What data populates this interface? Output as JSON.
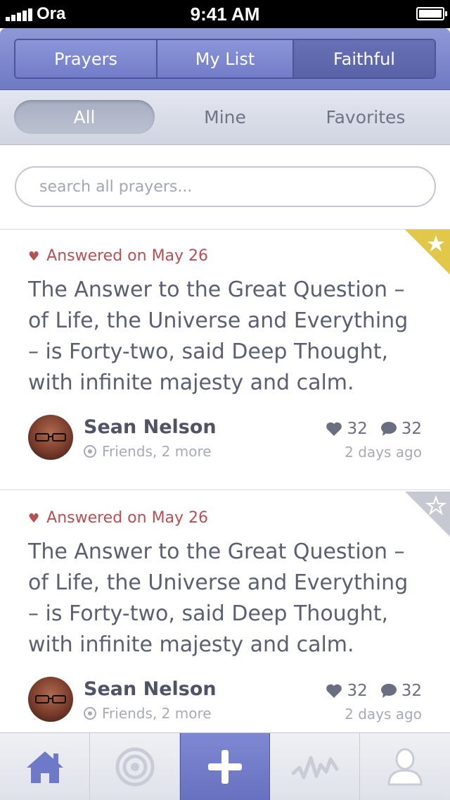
{
  "status_bar": {
    "carrier": "Ora",
    "time": "9:41 AM"
  },
  "nav": {
    "tabs": [
      {
        "label": "Prayers"
      },
      {
        "label": "My List"
      },
      {
        "label": "Faithful",
        "selected": true
      }
    ]
  },
  "filter": {
    "items": [
      {
        "label": "All",
        "selected": true
      },
      {
        "label": "Mine"
      },
      {
        "label": "Favorites"
      }
    ]
  },
  "search": {
    "placeholder": "search all prayers..."
  },
  "prayers": [
    {
      "status": "Answered on May 26",
      "text": "The Answer to the Great Question – of Life, the Universe and Everything – is Forty-two, said Deep Thought, with infinite majesty and calm.",
      "author": "Sean Nelson",
      "audience": "Friends, 2 more",
      "likes": "32",
      "comments": "32",
      "time": "2 days ago",
      "favorited": true
    },
    {
      "status": "Answered on May 26",
      "text": "The Answer to the Great Question – of Life, the Universe and Everything – is Forty-two, said Deep Thought, with infinite majesty and calm.",
      "author": "Sean Nelson",
      "audience": "Friends, 2 more",
      "likes": "32",
      "comments": "32",
      "time": "2 days ago",
      "favorited": false
    }
  ],
  "tabbar": {
    "items": [
      "home-icon",
      "target-icon",
      "plus-icon",
      "activity-icon",
      "profile-icon"
    ]
  },
  "colors": {
    "accent": "#727dc8",
    "answered": "#b84f52",
    "favorite": "#e2c84a",
    "text": "#5b5f72"
  }
}
